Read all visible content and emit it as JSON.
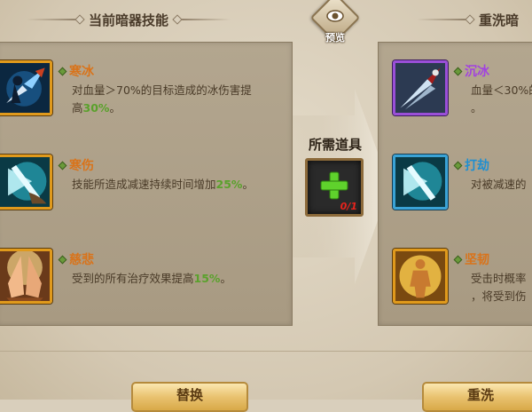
{
  "header": {
    "left_title": "当前暗器技能",
    "right_title": "重洗暗",
    "preview_label": "预览"
  },
  "current_skills": [
    {
      "name": "寒冰",
      "desc_line1": "对血量＞70%的目标造成的冰伤害提",
      "desc_line2_prefix": "高",
      "desc_line2_value": "30%",
      "desc_line2_suffix": "。",
      "name_color": "#d9731a",
      "icon": "ice-dagger-icon"
    },
    {
      "name": "寒伤",
      "desc_line1_prefix": "技能所造成减速持续时间增加",
      "desc_line1_value": "25%",
      "desc_line1_suffix": "。",
      "name_color": "#d9731a",
      "icon": "frost-blade-icon"
    },
    {
      "name": "慈悲",
      "desc_line1_prefix": "受到的所有治疗效果提高",
      "desc_line1_value": "15%",
      "desc_line1_suffix": "。",
      "name_color": "#d9731a",
      "icon": "praying-hands-icon"
    }
  ],
  "required_item": {
    "label": "所需道具",
    "count": "0/1",
    "icon": "plus-icon"
  },
  "reroll_skills": [
    {
      "name": "沉冰",
      "desc_line1": "血量＜30%的",
      "desc_line2": "。",
      "name_color": "#a242e0",
      "icon": "ice-spear-icon"
    },
    {
      "name": "打劫",
      "desc_line1": "对被减速的",
      "name_color": "#1f8fd1",
      "icon": "frost-blade-icon"
    },
    {
      "name": "坚韧",
      "desc_line1": "受击时概率",
      "desc_line2": "，将受到伤",
      "name_color": "#d9731a",
      "icon": "golden-body-icon"
    }
  ],
  "buttons": {
    "left": "替换",
    "right": "重洗"
  },
  "colors": {
    "orange_frame": "#e09a1c",
    "purple_frame": "#9a4fd8",
    "blue_frame": "#3aa3d6",
    "highlight_green": "#5aa12c"
  }
}
